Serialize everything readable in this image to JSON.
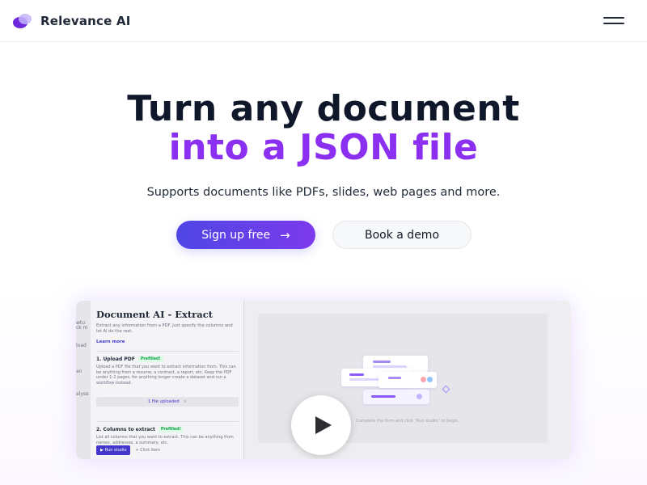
{
  "header": {
    "brand_name": "Relevance AI",
    "logo_icon": "relevance-logo-icon",
    "menu_icon": "hamburger-menu-icon"
  },
  "hero": {
    "title_line1": "Turn any document",
    "title_line2": "into a JSON file",
    "subtitle": "Supports documents like PDFs, slides, web pages and more.",
    "primary_button": "Sign up free",
    "primary_button_icon": "arrow-right-icon",
    "secondary_button": "Book a demo"
  },
  "video": {
    "play_icon": "play-icon",
    "panel": {
      "title": "Document AI - Extract",
      "description": "Extract any information from a PDF. Just specify the columns and let AI do the rest.",
      "learn_more": "Learn more",
      "step1_title": "1. Upload PDF",
      "step1_badge": "Prefilled!",
      "step1_text": "Upload a PDF file that you want to extract information from. This can be anything from a resume, a contract, a report, etc. Keep the PDF under 1-2 pages, for anything longer create a dataset and run a workflow instead.",
      "uploaded": "1 file uploaded",
      "uploaded_close": "×",
      "step2_title": "2. Columns to extract",
      "step2_badge": "Prefilled!",
      "step2_text": "List all columns that you want to extract. This can be anything from names, addresses, a summary, etc.",
      "run_button": "Run studio",
      "click_item": "Click item"
    },
    "canvas_caption": "Complete the form and click \"Run studio\" to begin.",
    "strip_texts": [
      "wtu",
      "ck m",
      "load",
      "an",
      "alyse"
    ]
  },
  "colors": {
    "accent_purple": "#8b2ff0",
    "button_gradient_start": "#4f46e5",
    "button_gradient_end": "#7c3aed"
  }
}
